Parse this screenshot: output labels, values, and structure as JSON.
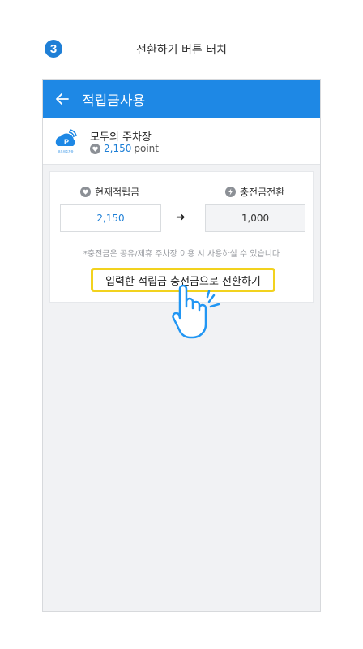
{
  "step": {
    "number": "3",
    "title": "전환하기 버튼 터치"
  },
  "appbar": {
    "title": "적립금사용",
    "back_icon": "arrow-left-icon"
  },
  "shop": {
    "name": "모두의 주차장",
    "points_value": "2,150",
    "points_unit": "point",
    "logo_text": "모두의주차장"
  },
  "card": {
    "current_label": "현재적립금",
    "convert_label": "충전금전환",
    "current_value": "2,150",
    "convert_value": "1,000",
    "notice": "*충전금은 공유/제휴 주차장 이용 시 사용하실 수 있습니다",
    "convert_button": "입력한 적립금 충전금으로 전환하기"
  },
  "colors": {
    "primary": "#1e88e5",
    "highlight": "#f2d21e"
  }
}
